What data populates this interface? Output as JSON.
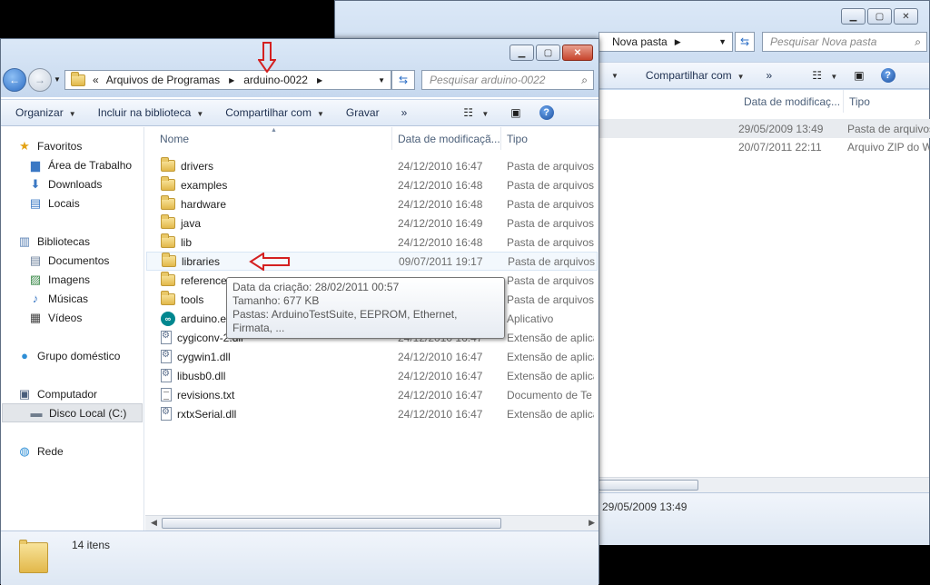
{
  "background_window": {
    "address_folder": "Nova pasta",
    "search_placeholder": "Pesquisar Nova pasta",
    "toolbar": {
      "share": "Compartilhar com",
      "more": "»"
    },
    "columns": {
      "date": "Data de modificaç...",
      "type": "Tipo"
    },
    "rows": [
      {
        "date": "29/05/2009 13:49",
        "type": "Pasta de arquivos"
      },
      {
        "date": "20/07/2011 22:11",
        "type": "Arquivo ZIP do W"
      }
    ],
    "details_date": "29/05/2009 13:49"
  },
  "window": {
    "breadcrumb": {
      "overflow": "«",
      "segments": [
        "Arquivos de Programas",
        "arduino-0022"
      ]
    },
    "search_placeholder": "Pesquisar arduino-0022",
    "toolbar": {
      "organize": "Organizar",
      "include_library": "Incluir na biblioteca",
      "share": "Compartilhar com",
      "burn": "Gravar",
      "more": "»"
    },
    "nav": {
      "favorites": {
        "label": "Favoritos",
        "items": [
          "Área de Trabalho",
          "Downloads",
          "Locais"
        ]
      },
      "libraries": {
        "label": "Bibliotecas",
        "items": [
          "Documentos",
          "Imagens",
          "Músicas",
          "Vídeos"
        ]
      },
      "homegroup": "Grupo doméstico",
      "computer": {
        "label": "Computador",
        "items": [
          "Disco Local (C:)"
        ]
      },
      "network": "Rede"
    },
    "columns": {
      "name": "Nome",
      "date": "Data de modificaçã...",
      "type": "Tipo"
    },
    "files": [
      {
        "name": "drivers",
        "date": "24/12/2010 16:47",
        "type": "Pasta de arquivos",
        "icon": "folder-icon"
      },
      {
        "name": "examples",
        "date": "24/12/2010 16:48",
        "type": "Pasta de arquivos",
        "icon": "folder-icon"
      },
      {
        "name": "hardware",
        "date": "24/12/2010 16:48",
        "type": "Pasta de arquivos",
        "icon": "folder-icon"
      },
      {
        "name": "java",
        "date": "24/12/2010 16:49",
        "type": "Pasta de arquivos",
        "icon": "folder-icon"
      },
      {
        "name": "lib",
        "date": "24/12/2010 16:48",
        "type": "Pasta de arquivos",
        "icon": "folder-icon"
      },
      {
        "name": "libraries",
        "date": "09/07/2011 19:17",
        "type": "Pasta de arquivos",
        "icon": "folder-icon"
      },
      {
        "name": "reference",
        "date": "",
        "type": "Pasta de arquivos",
        "icon": "folder-icon"
      },
      {
        "name": "tools",
        "date": "",
        "type": "Pasta de arquivos",
        "icon": "folder-icon"
      },
      {
        "name": "arduino.exe",
        "date": "",
        "type": "Aplicativo",
        "icon": "arduino-icon"
      },
      {
        "name": "cygiconv-2.dll",
        "date": "24/12/2010 16:47",
        "type": "Extensão de aplica",
        "icon": "dll-icon"
      },
      {
        "name": "cygwin1.dll",
        "date": "24/12/2010 16:47",
        "type": "Extensão de aplica",
        "icon": "dll-icon"
      },
      {
        "name": "libusb0.dll",
        "date": "24/12/2010 16:47",
        "type": "Extensão de aplica",
        "icon": "dll-icon"
      },
      {
        "name": "revisions.txt",
        "date": "24/12/2010 16:47",
        "type": "Documento de Te",
        "icon": "text-file-icon"
      },
      {
        "name": "rxtxSerial.dll",
        "date": "24/12/2010 16:47",
        "type": "Extensão de aplica",
        "icon": "dll-icon"
      }
    ],
    "tooltip": {
      "created": "Data da criação: 28/02/2011 00:57",
      "size": "Tamanho: 677 KB",
      "folders": "Pastas: ArduinoTestSuite, EEPROM, Ethernet, Firmata, ..."
    },
    "status": "14 itens"
  },
  "colors": {
    "annotation_arrow": "#d42020",
    "accent": "#3d6aa6"
  }
}
